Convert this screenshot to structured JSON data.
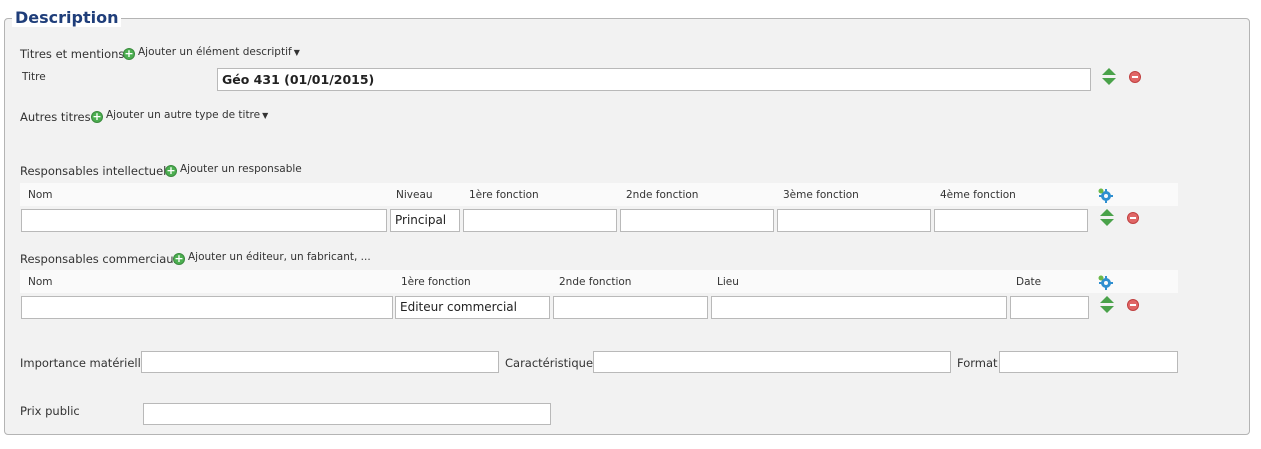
{
  "legend": "Description",
  "titres": {
    "label": "Titres et mentions",
    "add_link": "Ajouter un élément descriptif",
    "titre_label": "Titre",
    "titre_value": "Géo 431 (01/01/2015)"
  },
  "autres_titres": {
    "label": "Autres titres",
    "add_link": "Ajouter un autre type de titre"
  },
  "resp_intel": {
    "label": "Responsables intellectuels",
    "add_link": "Ajouter un responsable",
    "columns": [
      "Nom",
      "Niveau",
      "1ère fonction",
      "2nde fonction",
      "3ème fonction",
      "4ème fonction"
    ],
    "row": {
      "nom": "",
      "niveau": "Principal",
      "f1": "",
      "f2": "",
      "f3": "",
      "f4": ""
    }
  },
  "resp_comm": {
    "label": "Responsables commerciaux",
    "add_link": "Ajouter un éditeur, un fabricant, ...",
    "columns": [
      "Nom",
      "1ère fonction",
      "2nde fonction",
      "Lieu",
      "Date"
    ],
    "row": {
      "nom": "",
      "f1": "Editeur commercial",
      "f2": "",
      "lieu": "",
      "date": ""
    }
  },
  "materiel": {
    "importance_label": "Importance matérielle",
    "importance_value": "",
    "caracteristiques_label": "Caractéristiques",
    "caracteristiques_value": "",
    "format_label": "Format",
    "format_value": ""
  },
  "prix": {
    "label": "Prix public",
    "value": ""
  },
  "colors": {
    "legend": "#1f3e7a",
    "add": "#4caf50",
    "remove": "#e06666",
    "arrows": "#4aa24a",
    "gear": "#2f8fd0"
  }
}
